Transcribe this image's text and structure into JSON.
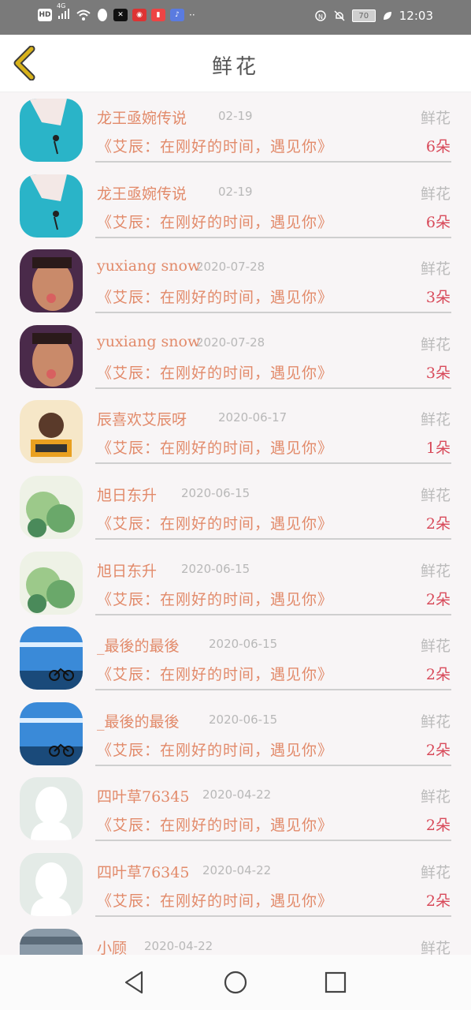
{
  "status": {
    "network": "HD",
    "signal_label": "4G",
    "battery": "70",
    "time": "12:03"
  },
  "header": {
    "title": "鲜花"
  },
  "rows": [
    {
      "name": "龙王亟婉传说",
      "date": "02-19",
      "kind": "鲜花",
      "book": "《艾辰：在刚好的时间，遇见你》",
      "count": "6朵",
      "avatar": "teal-hand"
    },
    {
      "name": "龙王亟婉传说",
      "date": "02-19",
      "kind": "鲜花",
      "book": "《艾辰：在刚好的时间，遇见你》",
      "count": "6朵",
      "avatar": "teal-hand"
    },
    {
      "name": "yuxiang snow",
      "date": "2020-07-28",
      "kind": "鲜花",
      "book": "《艾辰：在刚好的时间，遇见你》",
      "count": "3朵",
      "avatar": "portrait"
    },
    {
      "name": "yuxiang snow",
      "date": "2020-07-28",
      "kind": "鲜花",
      "book": "《艾辰：在刚好的时间，遇见你》",
      "count": "3朵",
      "avatar": "portrait"
    },
    {
      "name": "辰喜欢艾辰呀",
      "date": "2020-06-17",
      "kind": "鲜花",
      "book": "《艾辰：在刚好的时间，遇见你》",
      "count": "1朵",
      "avatar": "cartoon"
    },
    {
      "name": "旭日东升",
      "date": "2020-06-15",
      "kind": "鲜花",
      "book": "《艾辰：在刚好的时间，遇见你》",
      "count": "2朵",
      "avatar": "green"
    },
    {
      "name": "旭日东升",
      "date": "2020-06-15",
      "kind": "鲜花",
      "book": "《艾辰：在刚好的时间，遇见你》",
      "count": "2朵",
      "avatar": "green"
    },
    {
      "name": "_最後的最後",
      "date": "2020-06-15",
      "kind": "鲜花",
      "book": "《艾辰：在刚好的时间，遇见你》",
      "count": "2朵",
      "avatar": "bike"
    },
    {
      "name": "_最後的最後",
      "date": "2020-06-15",
      "kind": "鲜花",
      "book": "《艾辰：在刚好的时间，遇见你》",
      "count": "2朵",
      "avatar": "bike"
    },
    {
      "name": "四叶草76345",
      "date": "2020-04-22",
      "kind": "鲜花",
      "book": "《艾辰：在刚好的时间，遇见你》",
      "count": "2朵",
      "avatar": "default"
    },
    {
      "name": "四叶草76345",
      "date": "2020-04-22",
      "kind": "鲜花",
      "book": "《艾辰：在刚好的时间，遇见你》",
      "count": "2朵",
      "avatar": "default"
    },
    {
      "name": "小顾",
      "date": "2020-04-22",
      "kind": "鲜花",
      "book": "",
      "count": "",
      "avatar": "lake"
    }
  ],
  "icons": {
    "back": "chevron-left-icon",
    "nav_back": "triangle-back-icon",
    "nav_home": "circle-home-icon",
    "nav_recent": "square-recent-icon"
  },
  "colors": {
    "name": "#e28a6a",
    "count": "#d84a5a",
    "back_arrow": "#d8b21a"
  }
}
